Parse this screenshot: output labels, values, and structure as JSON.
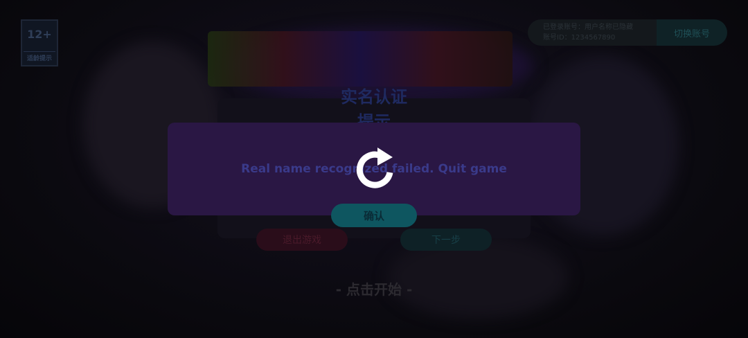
{
  "header": {
    "logo_number": "12+",
    "logo_caption": "适龄提示",
    "account_lines": [
      "已登录账号：用户名称已隐藏",
      "账号ID：1234567890"
    ],
    "switch_account_label": "切换账号"
  },
  "underlay": {
    "title_line1": "实名认证",
    "title_line2": "提示",
    "exit_label": "退出游戏",
    "next_label": "下一步",
    "tap_to_start": "- 点击开始 -"
  },
  "dialog": {
    "message": "Real name recognized failed. Quit game",
    "confirm_label": "确认"
  },
  "overlay": {
    "spinner_icon": "refresh-icon",
    "spinner_color": "#ffffff"
  }
}
